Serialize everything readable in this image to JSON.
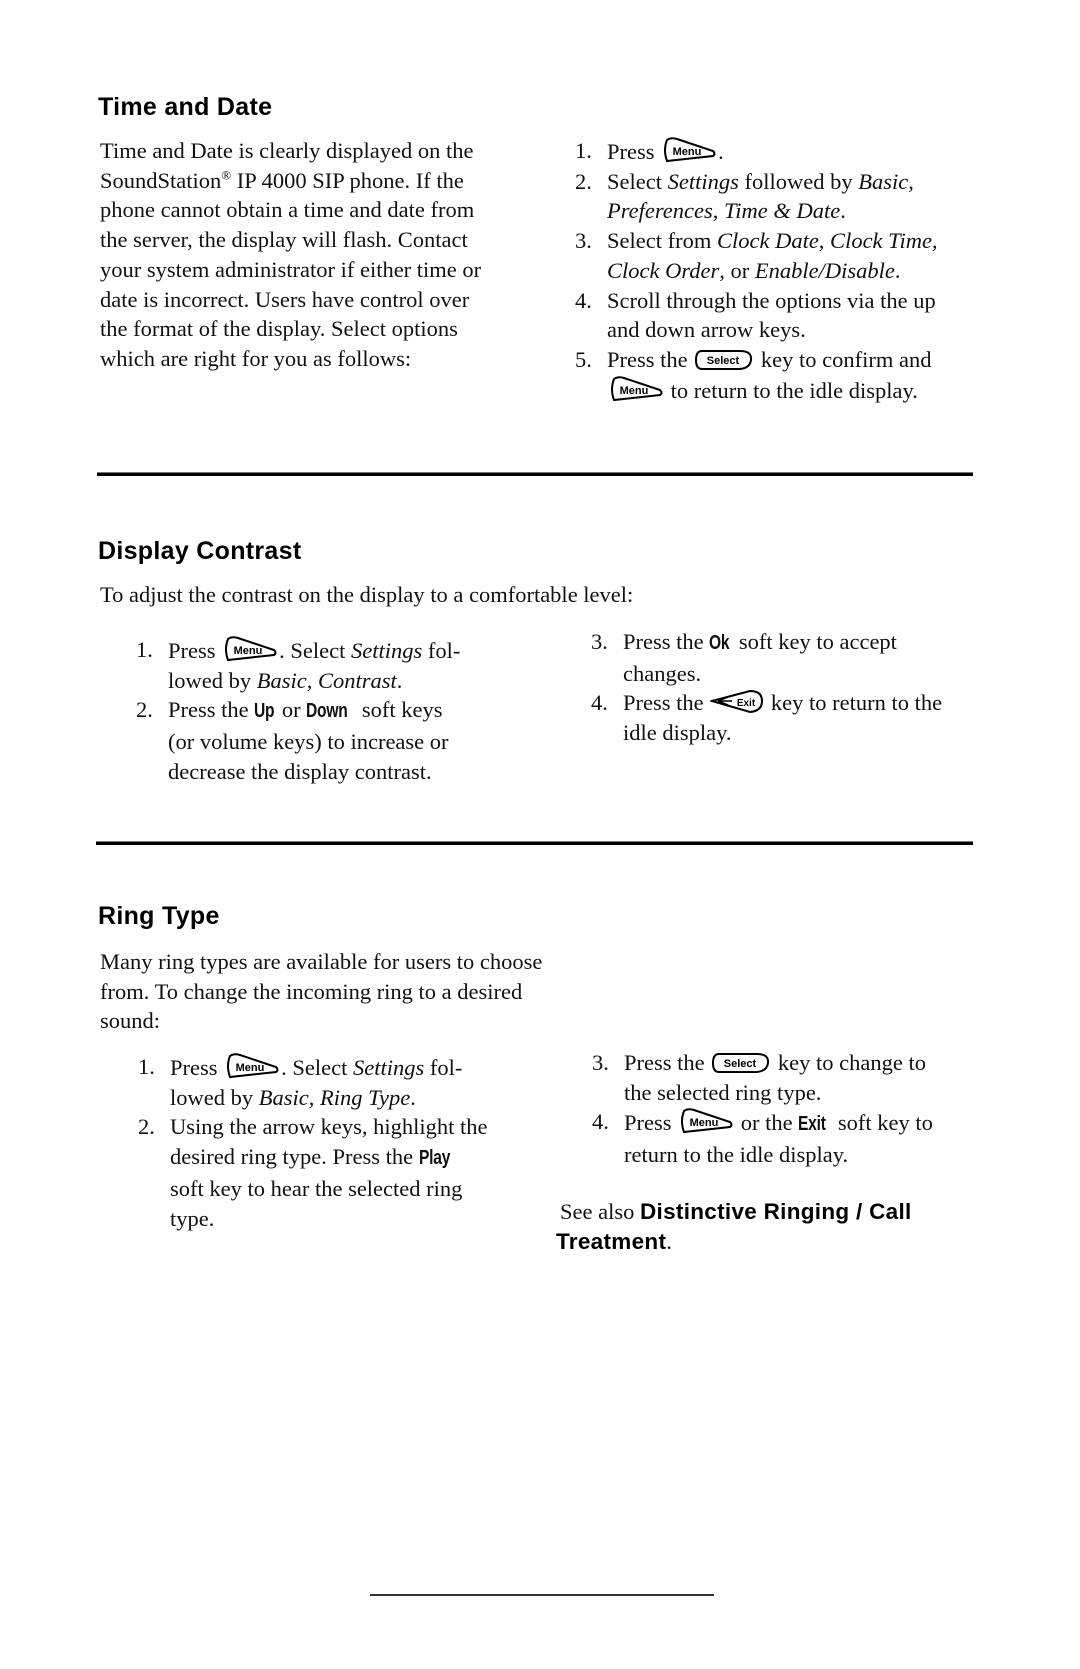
{
  "sections": {
    "time_date": {
      "title": "Time and Date",
      "intro": {
        "l1": "Time and Date is clearly displayed on the",
        "l2a": "SoundStation",
        "l2sup": "®",
        "l2b": " IP 4000 SIP phone.  If the",
        "l3": "phone cannot obtain a time and date from",
        "l4": "the server, the display will flash.  Contact",
        "l5": "your system administrator if either time or",
        "l6": "date is incorrect.  Users have control over",
        "l7": "the format of the display.  Select options",
        "l8": "which are right for you as follows:"
      },
      "steps": [
        {
          "num": "1.",
          "a": "Press ",
          "b": "."
        },
        {
          "num": "2.",
          "a": "Select ",
          "i1": "Settings",
          "b": " followed by ",
          "i2": "Basic,",
          "i3": "Preferences, Time & Date",
          "c": "."
        },
        {
          "num": "3.",
          "a": "Select from ",
          "i1": "Clock Date, Clock Time,",
          "i2": "Clock Order",
          "b": ", or ",
          "i3": "Enable/Disable",
          "c": "."
        },
        {
          "num": "4.",
          "a": "Scroll through the options via the up",
          "b": "and down arrow keys."
        },
        {
          "num": "5.",
          "a": "Press the ",
          "b": " key to confirm and",
          "c": " to return to the idle display."
        }
      ]
    },
    "contrast": {
      "title": "Display Contrast",
      "intro": "To adjust the contrast on the display to a comfortable level:",
      "steps": [
        {
          "num": "1.",
          "a": "Press ",
          "b": ".  Select ",
          "i1": "Settings",
          "c": " fol-",
          "d": "lowed by ",
          "i2": "Basic, Contrast",
          "e": "."
        },
        {
          "num": "2.",
          "a": "Press the ",
          "k1": "Up",
          "b": " or ",
          "k2": "Down",
          "c": " soft keys",
          "d": "(or volume keys) to increase or",
          "e": "decrease the display contrast."
        },
        {
          "num": "3.",
          "a": "Press the ",
          "k1": "Ok",
          "b": " soft key to accept",
          "c": "changes."
        },
        {
          "num": "4.",
          "a": "Press the ",
          "b": " key to return to the",
          "c": "idle display."
        }
      ]
    },
    "ring": {
      "title": "Ring Type",
      "intro": {
        "l1": "Many ring types are available for users to choose",
        "l2": "from.  To change the incoming ring to a desired",
        "l3": "sound:"
      },
      "steps": [
        {
          "num": "1.",
          "a": "Press ",
          "b": ".  Select ",
          "i1": "Settings",
          "c": " fol-",
          "d": "lowed by ",
          "i2": "Basic, Ring Type",
          "e": "."
        },
        {
          "num": "2.",
          "a": "Using the arrow keys, highlight the",
          "b": "desired ring type.  Press the ",
          "k1": "Play",
          "c": "soft key to hear the selected ring",
          "d": "type."
        },
        {
          "num": "3.",
          "a": "Press the ",
          "b": " key to change to",
          "c": "the selected ring type."
        },
        {
          "num": "4.",
          "a": "Press ",
          "b": " or the ",
          "k1": "Exit",
          "c": " soft key to",
          "d": "return to the idle display."
        }
      ],
      "see_also": {
        "prefix": "See also ",
        "link1": "Distinctive Ringing / Call",
        "link2": "Treatment",
        "suffix": "."
      }
    }
  },
  "keys": {
    "menu": "Menu",
    "select": "Select",
    "exit": "Exit"
  }
}
